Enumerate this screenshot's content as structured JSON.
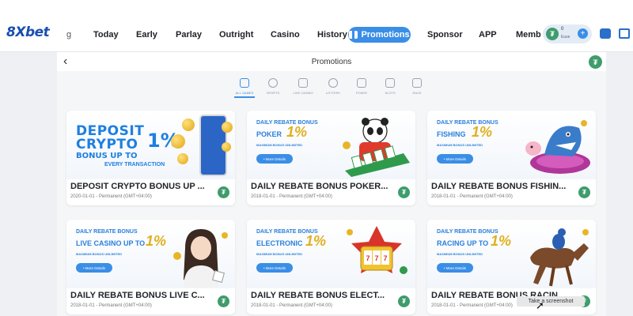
{
  "brand": {
    "logo_num": "8X",
    "logo_txt": "bet"
  },
  "nav": {
    "fragment": "g",
    "items": [
      "Today",
      "Early",
      "Parlay",
      "Outright",
      "Casino",
      "History"
    ],
    "active": "Promotions",
    "items_right": [
      "Sponsor",
      "APP",
      "Memb"
    ]
  },
  "balance": {
    "coin_symbol": "₮",
    "amount": "0",
    "currency": "Euse",
    "add_symbol": "+"
  },
  "page": {
    "back_symbol": "‹",
    "title": "Promotions",
    "avatar_symbol": "₮"
  },
  "filters": [
    {
      "label": "ALL GAMES",
      "icon": "grid-icon",
      "active": true
    },
    {
      "label": "SPORTS",
      "icon": "ball-icon",
      "active": false
    },
    {
      "label": "LIVE CASINO",
      "icon": "cards-icon",
      "active": false
    },
    {
      "label": "LOTTERY",
      "icon": "lottery-icon",
      "active": false
    },
    {
      "label": "POKER",
      "icon": "poker-icon",
      "active": false
    },
    {
      "label": "SLOTS",
      "icon": "slots-icon",
      "active": false
    },
    {
      "label": "RACE",
      "icon": "race-icon",
      "active": false
    }
  ],
  "cards": [
    {
      "title": "DEPOSIT CRYPTO BONUS UP ...",
      "meta": "2020-01-01 - Permanent (GMT+04:00)",
      "banner": {
        "l1": "DEPOSIT",
        "l2": "CRYPTO",
        "l3": "BONUS UP TO",
        "pct": "1%",
        "l4": "EVERY TRANSACTION"
      }
    },
    {
      "title": "DAILY REBATE BONUS POKER...",
      "meta": "2018-01-01 - Permanent (GMT+04:00)",
      "banner": {
        "head": "DAILY REBATE BONUS",
        "main": "POKER",
        "pct": "1%",
        "sub": "MAXIMUM BONUS UNLIMITED",
        "btn": "• More Details"
      }
    },
    {
      "title": "DAILY REBATE BONUS FISHIN...",
      "meta": "2018-01-01 - Permanent (GMT+04:00)",
      "banner": {
        "head": "DAILY REBATE BONUS",
        "main": "FISHING",
        "pct": "1%",
        "sub": "MAXIMUM BONUS UNLIMITED",
        "btn": "• More Details"
      }
    },
    {
      "title": "DAILY REBATE BONUS LIVE C...",
      "meta": "2018-01-01 - Permanent (GMT+04:00)",
      "banner": {
        "head": "DAILY REBATE BONUS",
        "main": "LIVE CASINO UP TO",
        "pct": "1%",
        "sub": "MAXIMUM BONUS UNLIMITED",
        "btn": "• More Details"
      }
    },
    {
      "title": "DAILY REBATE BONUS ELECT...",
      "meta": "2018-01-01 - Permanent (GMT+04:00)",
      "banner": {
        "head": "DAILY REBATE BONUS",
        "main": "ELECTRONIC",
        "pct": "1%",
        "sub": "MAXIMUM BONUS UNLIMITED",
        "btn": "• More Details"
      }
    },
    {
      "title": "DAILY REBATE BONUS RACIN...",
      "meta": "2018-01-01 - Permanent (GMT+04:00)",
      "banner": {
        "head": "DAILY REBATE BONUS",
        "main": "RACING UP TO",
        "pct": "1%",
        "sub": "MAXIMUM BONUS UNLIMITED",
        "btn": "• More Details"
      }
    }
  ],
  "card_avatar_symbol": "₮",
  "tooltip": "Take a screenshot",
  "colors": {
    "accent": "#3a8ee6",
    "brand_blue": "#1a4fae",
    "gold": "#e0b020",
    "avatar_green": "#3f9c6c"
  }
}
